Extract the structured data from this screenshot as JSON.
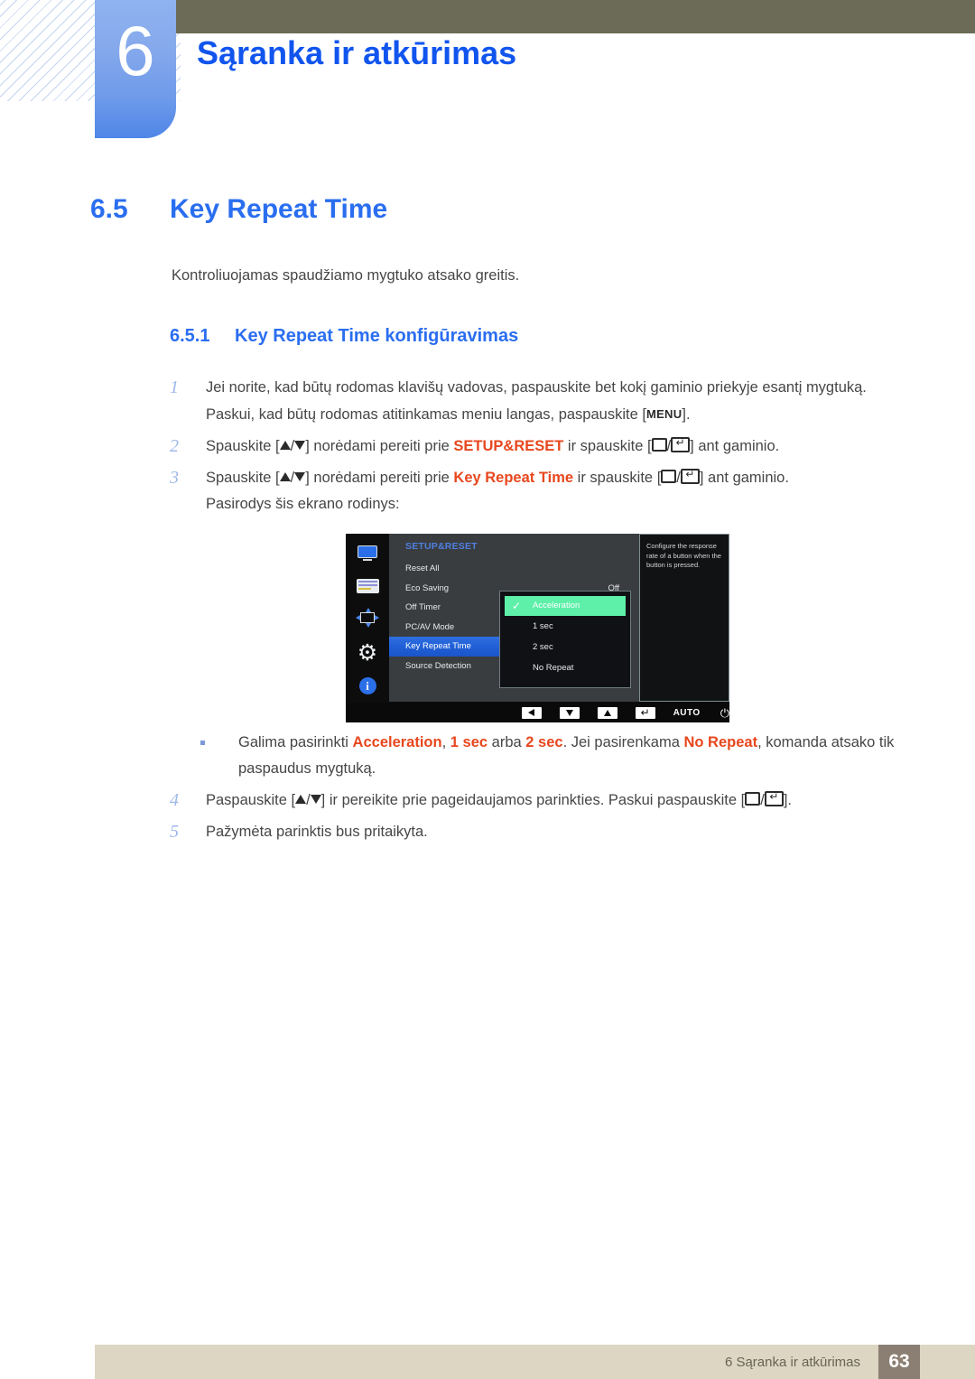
{
  "header": {
    "chapter_number": "6",
    "chapter_title": "Sąranka ir atkūrimas"
  },
  "section": {
    "number": "6.5",
    "title": "Key Repeat Time",
    "intro": "Kontroliuojamas spaudžiamo mygtuko atsako greitis.",
    "subsection_number": "6.5.1",
    "subsection_title": "Key Repeat Time konfigūravimas"
  },
  "steps": [
    {
      "marker": "1",
      "line1_a": "Jei norite, kad būtų rodomas klavišų vadovas, paspauskite bet kokį gaminio priekyje esantį mygtuką.",
      "line2_a": "Paskui, kad būtų rodomas atitinkamas meniu langas, paspauskite [",
      "menu_key": "MENU",
      "line2_b": "]."
    },
    {
      "marker": "2",
      "a": "Spauskite [",
      "b": "] norėdami pereiti prie ",
      "keyword": "SETUP&RESET",
      "c": " ir spauskite [",
      "d": "] ant gaminio."
    },
    {
      "marker": "3",
      "a": "Spauskite [",
      "b": "] norėdami pereiti prie ",
      "keyword": "Key Repeat Time",
      "c": " ir spauskite [",
      "d": "] ant gaminio.",
      "line2": "Pasirodys šis ekrano rodinys:"
    },
    {
      "marker": "4",
      "a": "Paspauskite [",
      "b": "] ir pereikite prie pageidaujamos parinkties. Paskui paspauskite [",
      "c": "]."
    },
    {
      "marker": "5",
      "a": "Pažymėta parinktis bus pritaikyta."
    }
  ],
  "note": {
    "a": "Galima pasirinkti ",
    "kw1": "Acceleration",
    "b": ", ",
    "kw2": "1 sec",
    "c": " arba ",
    "kw3": "2 sec",
    "d": ". Jei pasirenkama ",
    "kw4": "No Repeat",
    "e": ", komanda atsako tik paspaudus mygtuką."
  },
  "osd": {
    "menu_title": "SETUP&RESET",
    "sidebar_icons": [
      "monitor-icon",
      "picture-list-icon",
      "position-arrows-icon",
      "gear-icon",
      "info-icon"
    ],
    "items": [
      {
        "label": "Reset All",
        "value": "",
        "active": false
      },
      {
        "label": "Eco Saving",
        "value": "Off",
        "active": false
      },
      {
        "label": "Off Timer",
        "value": "",
        "active": false
      },
      {
        "label": "PC/AV Mode",
        "value": "",
        "active": false
      },
      {
        "label": "Key Repeat Time",
        "value": "",
        "active": true
      },
      {
        "label": "Source Detection",
        "value": "",
        "active": false
      }
    ],
    "dropdown": [
      {
        "label": "Acceleration",
        "selected": true
      },
      {
        "label": "1 sec",
        "selected": false
      },
      {
        "label": "2 sec",
        "selected": false
      },
      {
        "label": "No Repeat",
        "selected": false
      }
    ],
    "tooltip": "Configure the response rate of a button when the button is pressed.",
    "bottom_bar": {
      "auto_label": "AUTO",
      "power_glyph": "⏻"
    },
    "colors": {
      "highlight_blue": "#2f6fe0",
      "selected_green": "#5ef0a8",
      "title_blue": "#4f7fe0"
    }
  },
  "footer": {
    "text": "6 Sąranka ir atkūrimas",
    "page": "63"
  }
}
